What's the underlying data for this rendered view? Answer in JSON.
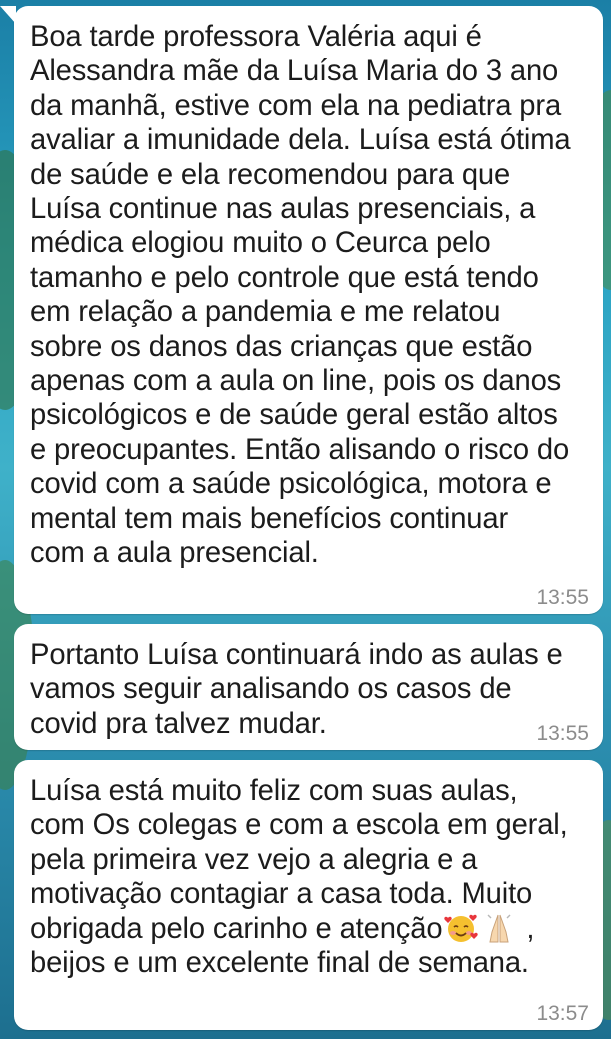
{
  "messages": [
    {
      "text": "Boa tarde professora Valéria aqui é\nAlessandra mãe da Luísa Maria do 3 ano\nda manhã, estive com ela na pediatra pra\navaliar a imunidade dela. Luísa está ótima\nde saúde e ela recomendou para que\nLuísa continue nas aulas presenciais, a\nmédica elogiou muito o Ceurca  pelo\ntamanho e pelo controle que está tendo\nem relação a pandemia e me relatou\nsobre os danos das crianças que estão\napenas com a aula on line, pois os danos\npsicológicos e de saúde geral estão altos\ne preocupantes. Então alisando o risco do\ncovid com a saúde psicológica, motora e\nmental tem mais benefícios continuar\ncom a aula presencial.",
      "time": "13:55"
    },
    {
      "text": "Portanto Luísa continuará indo as aulas e\nvamos seguir analisando os casos de\ncovid pra talvez mudar.",
      "time": "13:55"
    },
    {
      "text_before_emoji": "Luísa está muito feliz com suas aulas,\ncom Os colegas e com a escola em geral,\npela primeira vez vejo a alegria e a\nmotivação contagiar a casa toda. Muito\nobrigada pelo carinho e atenção",
      "emojis": [
        "smiling-face-with-hearts",
        "folded-hands"
      ],
      "text_after_emoji": " ,\nbeijos e um excelente final de semana.",
      "time": "13:57"
    }
  ]
}
